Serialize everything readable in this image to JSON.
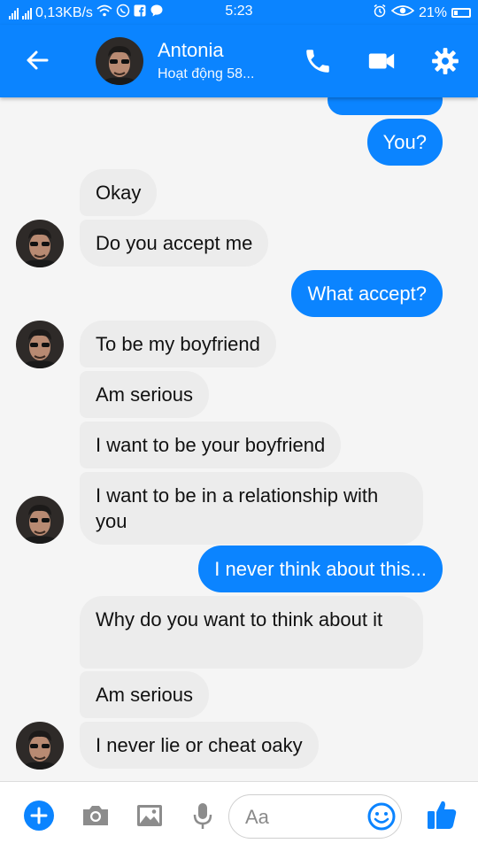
{
  "status_bar": {
    "network_speed": "0,13KB/s",
    "time": "5:23",
    "battery": "21%"
  },
  "header": {
    "name": "Antonia",
    "status": "Hoạt động 58..."
  },
  "messages": [
    {
      "from": "me",
      "text": "You?"
    },
    {
      "from": "them",
      "text": "Okay"
    },
    {
      "from": "them",
      "text": "Do you accept me"
    },
    {
      "from": "me",
      "text": "What accept?"
    },
    {
      "from": "them",
      "text": "To be my boyfriend"
    },
    {
      "from": "them",
      "text": "Am serious"
    },
    {
      "from": "them",
      "text": "I want to be your boyfriend"
    },
    {
      "from": "them",
      "text": "I want to be in a relationship with you"
    },
    {
      "from": "me",
      "text": "I never think about this..."
    },
    {
      "from": "them",
      "text": "Why do you want to think about it"
    },
    {
      "from": "them",
      "text": "Am serious"
    },
    {
      "from": "them",
      "text": "I never lie or cheat oaky"
    }
  ],
  "composer": {
    "placeholder": "Aa"
  },
  "colors": {
    "accent": "#0b84ff",
    "incoming_bubble": "#ececec"
  }
}
